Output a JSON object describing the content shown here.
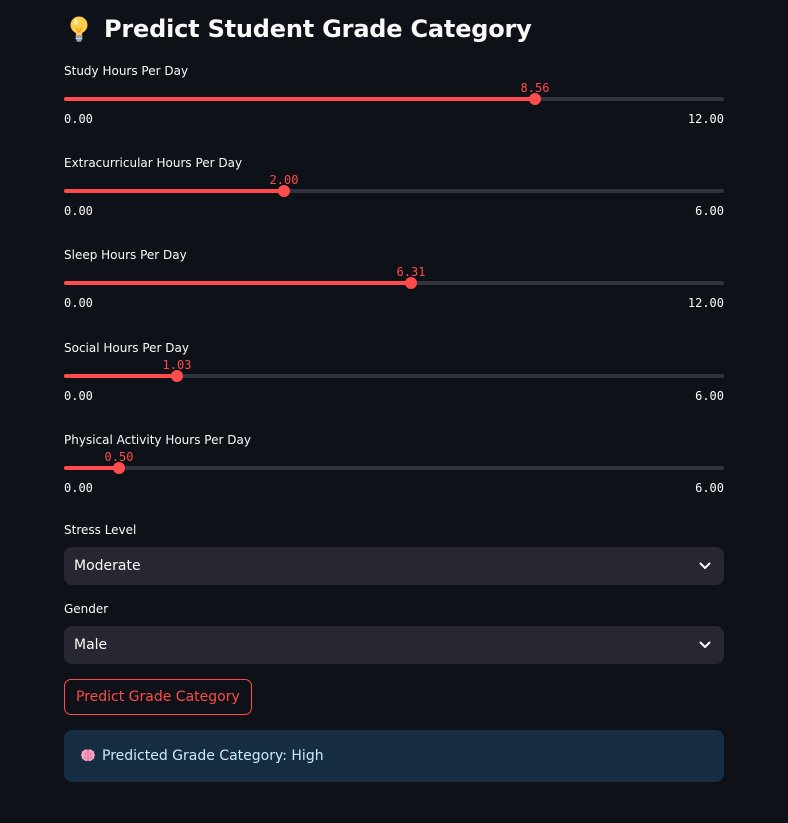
{
  "header": {
    "title": "Predict Student Grade Category",
    "icon": "lightbulb-icon"
  },
  "sliders": [
    {
      "label": "Study Hours Per Day",
      "value": "8.56",
      "min": "0.00",
      "max": "12.00",
      "fraction": 0.7133
    },
    {
      "label": "Extracurricular Hours Per Day",
      "value": "2.00",
      "min": "0.00",
      "max": "6.00",
      "fraction": 0.3333
    },
    {
      "label": "Sleep Hours Per Day",
      "value": "6.31",
      "min": "0.00",
      "max": "12.00",
      "fraction": 0.5258
    },
    {
      "label": "Social Hours Per Day",
      "value": "1.03",
      "min": "0.00",
      "max": "6.00",
      "fraction": 0.1717
    },
    {
      "label": "Physical Activity Hours Per Day",
      "value": "0.50",
      "min": "0.00",
      "max": "6.00",
      "fraction": 0.0833
    }
  ],
  "selects": [
    {
      "label": "Stress Level",
      "value": "Moderate"
    },
    {
      "label": "Gender",
      "value": "Male"
    }
  ],
  "button": {
    "label": "Predict Grade Category"
  },
  "result": {
    "icon": "brain-icon",
    "text": "Predicted Grade Category: High"
  },
  "colors": {
    "background": "#0e1117",
    "accent": "#ff4b4b",
    "track": "#31333f",
    "select_bg": "#262730",
    "info_bg": "#172d43",
    "info_text": "#c7ebff"
  }
}
